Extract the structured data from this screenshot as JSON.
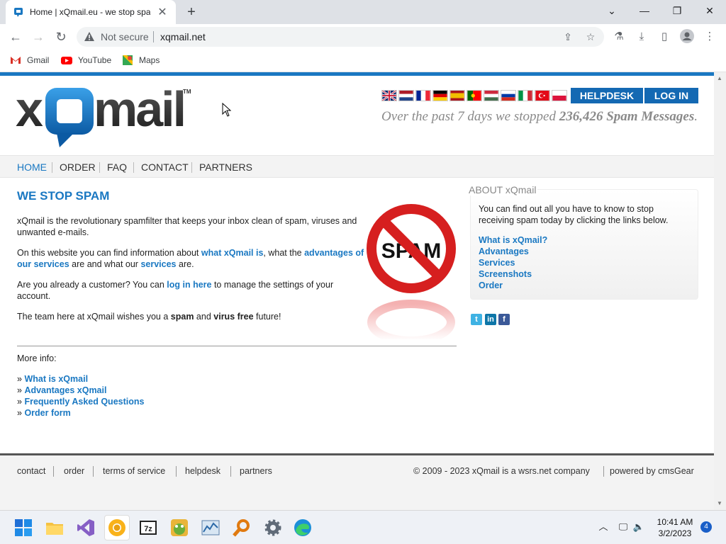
{
  "browser": {
    "tab_title": "Home | xQmail.eu - we stop spam",
    "not_secure": "Not secure",
    "url": "xqmail.net",
    "bookmarks": [
      {
        "label": "Gmail"
      },
      {
        "label": "YouTube"
      },
      {
        "label": "Maps"
      }
    ]
  },
  "header": {
    "logo_text": "xQmail",
    "helpdesk_label": "HELPDESK",
    "login_label": "LOG IN",
    "tagline_prefix": "Over the past 7 days we stopped",
    "tagline_count": "236,426 Spam Messages",
    "tagline_suffix": "."
  },
  "nav": {
    "items": [
      "HOME",
      "ORDER",
      "FAQ",
      "CONTACT",
      "PARTNERS"
    ]
  },
  "main": {
    "heading": "WE STOP SPAM",
    "p1": "xQmail is the revolutionary spamfilter that keeps your inbox clean of spam, viruses and unwanted e-mails.",
    "p2_a": "On this website you can find information about",
    "p2_link1": "what xQmail is",
    "p2_b": ",  what the",
    "p2_link2": "advantages of our services",
    "p2_c": "are and what our",
    "p2_link3": "services",
    "p2_d": "are.",
    "p3_a": "Are you already a customer? You can",
    "p3_link": "log in here",
    "p3_b": "to manage the settings of your account.",
    "p4_a": "The team here at xQmail wishes you a",
    "p4_b1": "spam",
    "p4_c": "and",
    "p4_b2": "virus free",
    "p4_d": "future!",
    "spam_sign_text": "SPAM",
    "more_info_label": "More info:",
    "more_links": [
      "What is xQmail",
      "Advantages xQmail",
      "Frequently Asked Questions",
      "Order form"
    ]
  },
  "about": {
    "legend": "ABOUT xQmail",
    "text": "You can find out all you have to know to stop receiving spam today by clicking the links below.",
    "links": [
      "What is xQmail?",
      "Advantages",
      "Services",
      "Screenshots",
      "Order"
    ]
  },
  "footer": {
    "links": [
      "contact",
      "order",
      "terms of service",
      "helpdesk",
      "partners"
    ],
    "copyright": "© 2009 - 2023 xQmail is a wsrs.net company",
    "powered": "powered by cmsGear"
  },
  "taskbar": {
    "time": "10:41 AM",
    "date": "3/2/2023",
    "notifications": "4"
  },
  "colors": {
    "brand_blue": "#1a78c2",
    "button_blue": "#1469b3"
  }
}
